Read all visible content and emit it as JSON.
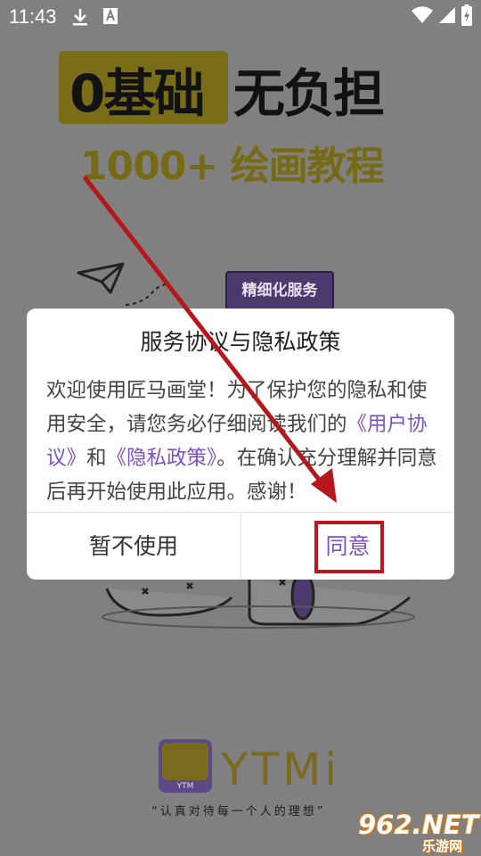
{
  "status_bar": {
    "time": "11:43",
    "download_icon": "download-icon",
    "notification_icon": "font-a-icon",
    "wifi_icon": "wifi-icon",
    "signal_icon": "signal-icon",
    "battery_icon": "battery-charging-icon"
  },
  "poster": {
    "headline_left": "0基础",
    "headline_right": "无负担",
    "subheadline": "1000+ 绘画教程",
    "feature_tag": "精细化服务"
  },
  "dialog": {
    "title": "服务协议与隐私政策",
    "body_part1": "欢迎使用匠马画堂！为了保护您的隐私和使用安全，请您务必仔细阅读我们的",
    "user_agreement_link": "《用户协议》",
    "body_and": "和",
    "privacy_policy_link": "《隐私政策》",
    "body_part2": "。在确认充分理解并同意后再开始使用此应用。感谢！",
    "decline_label": "暂不使用",
    "accept_label": "同意"
  },
  "footer": {
    "logo_text": "YTMi",
    "logo_badge": "YTM",
    "slogan": "“认真对待每一个人的理想”"
  },
  "watermark": {
    "number": "962.NET",
    "subtitle": "乐游网"
  },
  "colors": {
    "overlay": "#808080",
    "link": "#7a52c4",
    "annotation": "#c0151a"
  }
}
